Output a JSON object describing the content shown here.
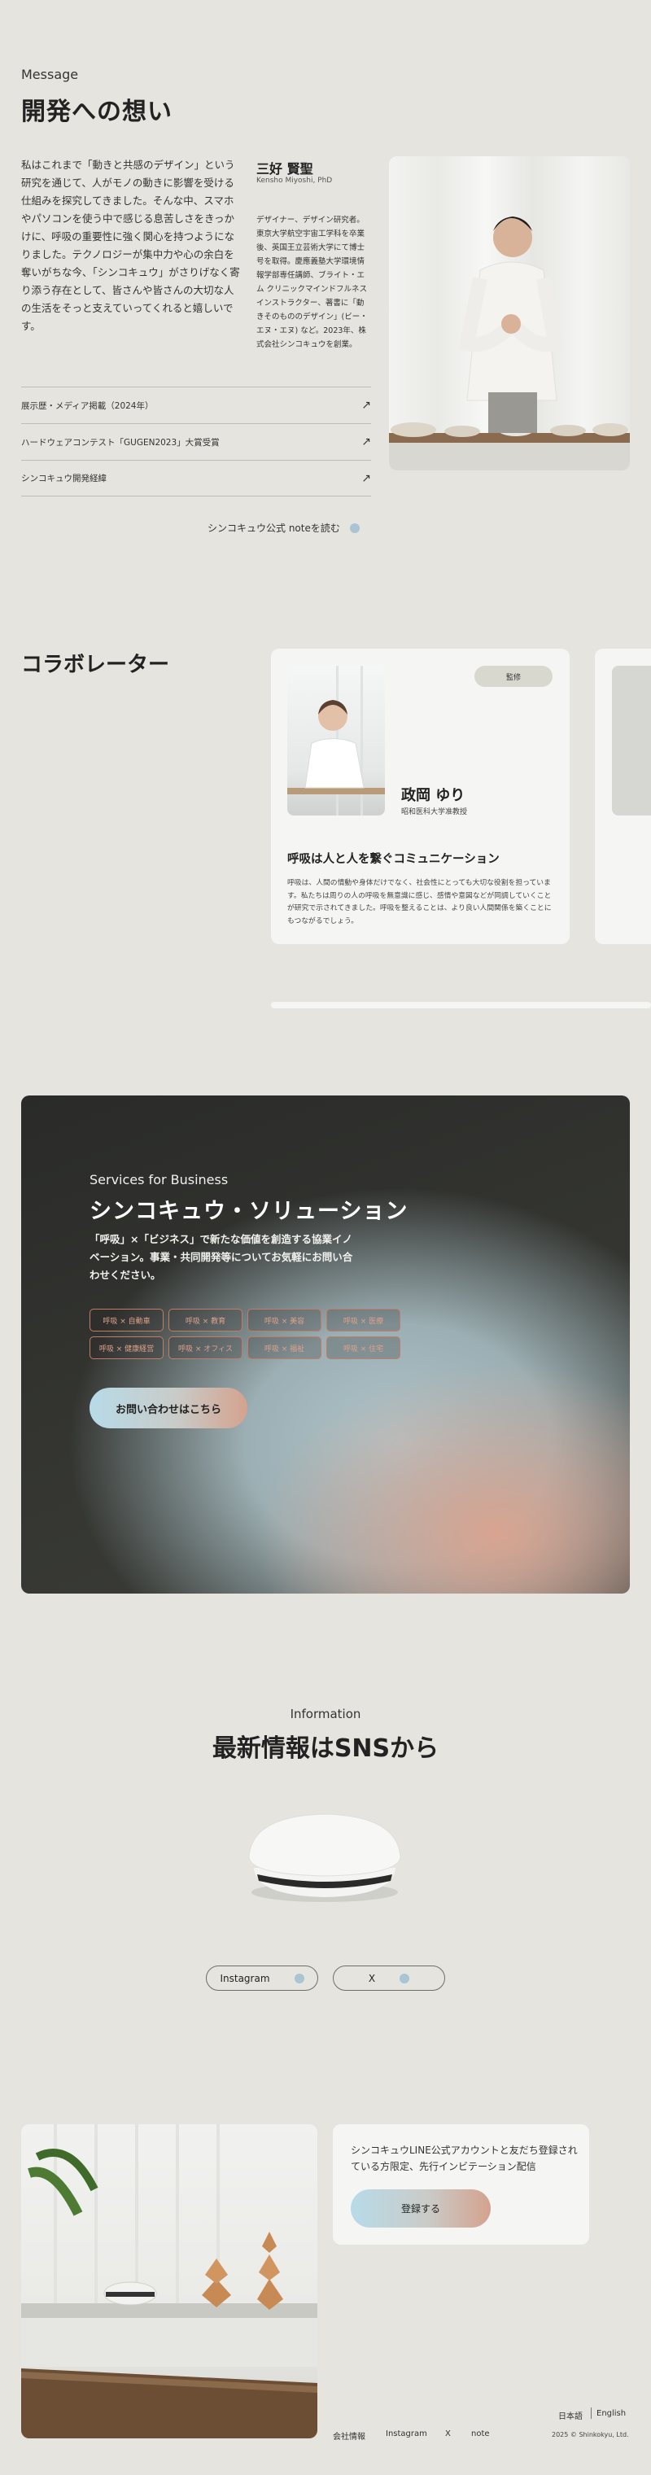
{
  "message": {
    "eyebrow": "Message",
    "title": "開発への想い",
    "body": "私はこれまで「動きと共感のデザイン」という研究を通じて、人がモノの動きに影響を受ける仕組みを探究してきました。そんな中、スマホやパソコンを使う中で感じる息苦しさをきっかけに、呼吸の重要性に強く関心を持つようになりました。テクノロジーが集中力や心の余白を奪いがちな今、「シンコキュウ」がさりげなく寄り添う存在として、皆さんや皆さんの大切な人の生活をそっと支えていってくれると嬉しいです。",
    "person_name": "三好 賢聖",
    "person_roman": "Kensho Miyoshi, PhD",
    "person_bio": "デザイナー、デザイン研究者。東京大学航空宇宙工学科を卒業後、英国王立芸術大学にて博士号を取得。慶應義塾大学環境情報学部専任講師、ブライト・エム クリニックマインドフルネスインストラクター、著書に「動きそのもののデザイン」(ビー・エヌ・エヌ) など。2023年、株式会社シンコキュウを創業。",
    "links": [
      {
        "label": "展示歴・メディア掲載（2024年）",
        "arrow": "↗"
      },
      {
        "label": "ハードウェアコンテスト「GUGEN2023」大賞受賞",
        "arrow": "↗"
      },
      {
        "label": "シンコキュウ開発経緯",
        "arrow": "↗"
      }
    ],
    "note_link": "シンコキュウ公式 noteを読む"
  },
  "collaborators": {
    "title": "コラボレーター",
    "badge": "監修",
    "name": "政岡 ゆり",
    "affiliation": "昭和医科大学准教授",
    "heading": "呼吸は人と人を繋ぐコミュニケーション",
    "text": "呼吸は、人間の情動や身体だけでなく、社会性にとっても大切な役割を担っています。私たちは周りの人の呼吸を無意識に感じ、感情や意図などが同調していくことが研究で示されてきました。呼吸を整えることは、より良い人間関係を築くことにもつながるでしょう。"
  },
  "business": {
    "eyebrow": "Services for Business",
    "title": "シンコキュウ・ソリューション",
    "text": "「呼吸」×「ビジネス」で新たな価値を創造する協業イノベーション。事業・共同開発等についてお気軽にお問い合わせください。",
    "tags": [
      "呼吸 × 自動車",
      "呼吸 × 教育",
      "呼吸 × 美容",
      "呼吸 × 医療",
      "呼吸 × 健康経営",
      "呼吸 × オフィス",
      "呼吸 × 福祉",
      "呼吸 × 住宅"
    ],
    "cta": "お問い合わせはこちら"
  },
  "information": {
    "eyebrow": "Information",
    "title": "最新情報はSNSから",
    "sns": [
      {
        "label": "Instagram"
      },
      {
        "label": "X"
      }
    ]
  },
  "line": {
    "text": "シンコキュウLINE公式アカウントと友だち登録されている方限定、先行インビテーション配信",
    "button": "登録する"
  },
  "footer": {
    "lang_ja": "日本語",
    "lang_en": "English",
    "links": [
      "会社情報",
      "Instagram",
      "X",
      "note"
    ],
    "copyright": "2025 © Shinkokyu, Ltd."
  },
  "colors": {
    "background": "#e5e4de",
    "accent_blue": "#a9c4d3",
    "accent_peach": "#d4a28e"
  }
}
